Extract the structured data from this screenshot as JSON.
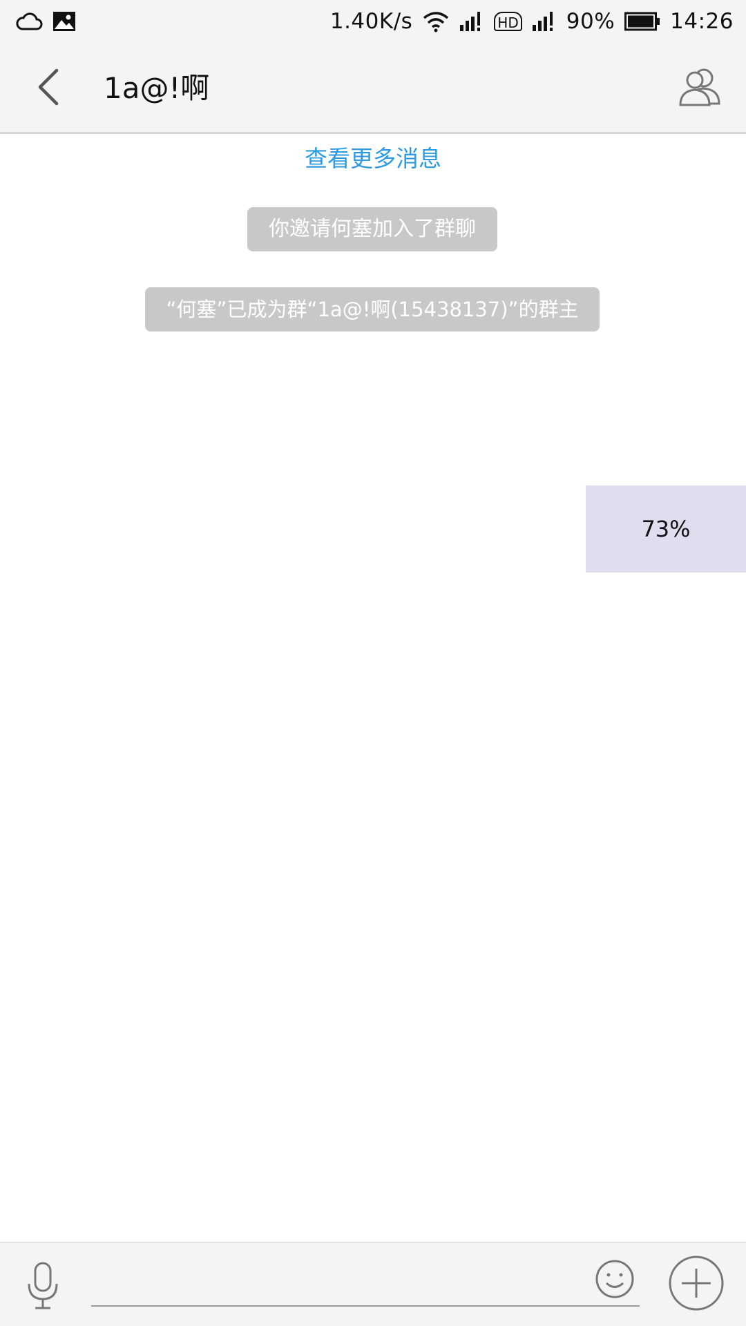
{
  "status_bar": {
    "network_speed": "1.40K/s",
    "battery": "90%",
    "time": "14:26",
    "hd_label": "HD",
    "icons": [
      "cloud-icon",
      "image-icon",
      "wifi-icon",
      "signal-icon",
      "hd-icon",
      "signal-icon",
      "battery-icon"
    ]
  },
  "header": {
    "title": "1a@!啊",
    "back_icon": "chevron-left-icon",
    "members_icon": "group-members-icon"
  },
  "messages": {
    "more_link": "查看更多消息",
    "system": [
      "你邀请何塞加入了群聊",
      "“何塞”已成为群“1a@!啊(15438137)”的群主"
    ],
    "progress": "73%"
  },
  "input_bar": {
    "message_value": "",
    "voice_icon": "microphone-icon",
    "emoji_icon": "smiley-icon",
    "plus_icon": "plus-circle-icon"
  },
  "colors": {
    "link": "#2e9ae0",
    "system_bubble": "#c8c8c8",
    "progress_bg": "#dedeef",
    "bar_bg": "#f4f4f4"
  }
}
